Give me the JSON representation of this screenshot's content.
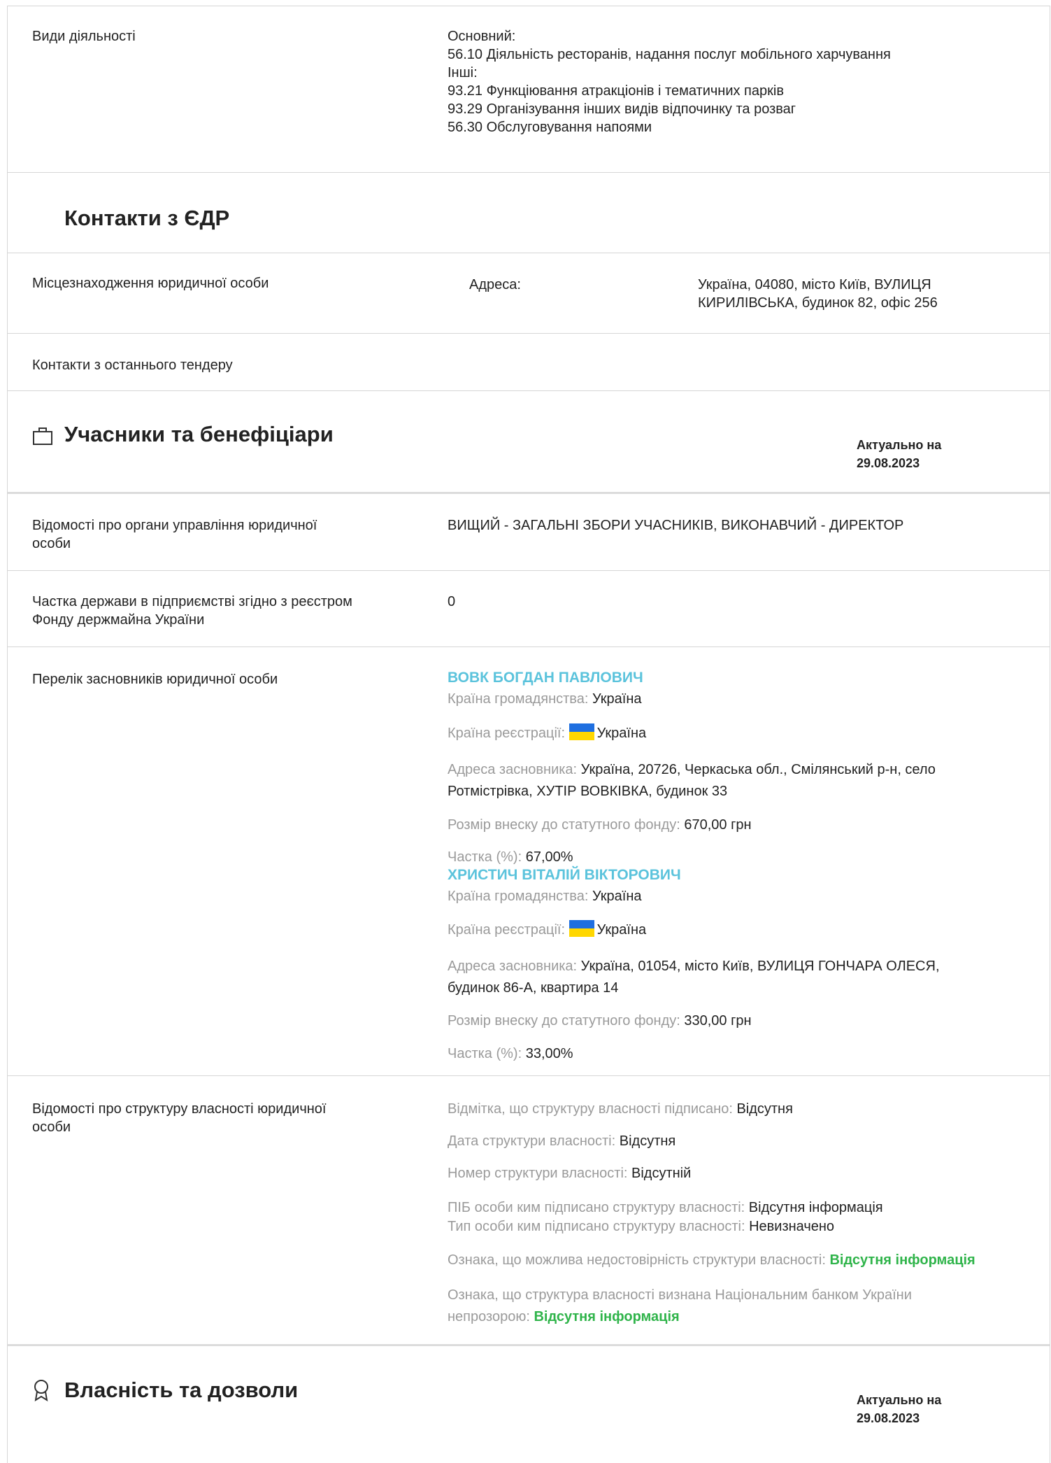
{
  "activities": {
    "label": "Види діяльності",
    "main_heading": "Основний:",
    "main_item": "56.10 Діяльність ресторанів, надання послуг мобільного харчування",
    "other_heading": "Інші:",
    "other_items": [
      "93.21 Функціювання атракціонів і тематичних парків",
      "93.29 Організування інших видів відпочинку та розваг",
      "56.30 Обслуговування напоями"
    ]
  },
  "contacts": {
    "title": "Контакти з ЄДР",
    "location_label": "Місцезнаходження юридичної особи",
    "address_label": "Адреса:",
    "address_line1": "Україна, 04080, місто Київ, ВУЛИЦЯ",
    "address_line2": "КИРИЛІВСЬКА, будинок 82, офіс 256",
    "tender_label": "Контакти з останнього тендеру"
  },
  "participants": {
    "title": "Учасники та бенефіціари",
    "actual_label": "Актуально на",
    "actual_date": "29.08.2023",
    "management_label_1": "Відомості про органи управління юридичної",
    "management_label_2": "особи",
    "management_value": "ВИЩИЙ - ЗАГАЛЬНІ ЗБОРИ УЧАСНИКІВ, ВИКОНАВЧИЙ - ДИРЕКТОР",
    "state_share_label_1": "Частка держави в підприємстві згідно з реєстром",
    "state_share_label_2": "Фонду держмайна України",
    "state_share_value": "0",
    "founders_label": "Перелік засновників юридичної особи",
    "founders": [
      {
        "name": "ВОВК БОГДАН ПАВЛОВИЧ",
        "citizenship_label": "Країна громадянства:",
        "citizenship": "Україна",
        "registration_label": "Країна реєстрації:",
        "registration": "Україна",
        "address_label": "Адреса засновника:",
        "address_line1": "Україна, 20726, Черкаська обл., Смілянський р-н, село",
        "address_line2": "Ротмістрівка, ХУТІР ВОВКІВКА, будинок 33",
        "contribution_label": "Розмір внеску до статутного фонду:",
        "contribution": "670,00 грн",
        "share_label": "Частка (%):",
        "share": "67,00%"
      },
      {
        "name": "ХРИСТИЧ ВІТАЛІЙ ВІКТОРОВИЧ",
        "citizenship_label": "Країна громадянства:",
        "citizenship": "Україна",
        "registration_label": "Країна реєстрації:",
        "registration": "Україна",
        "address_label": "Адреса засновника:",
        "address_line1": "Україна, 01054, місто Київ, ВУЛИЦЯ ГОНЧАРА ОЛЕСЯ,",
        "address_line2": "будинок 86-А, квартира 14",
        "contribution_label": "Розмір внеску до статутного фонду:",
        "contribution": "330,00 грн",
        "share_label": "Частка (%):",
        "share": "33,00%"
      }
    ],
    "ownership_label_1": "Відомості про структуру власності юридичної",
    "ownership_label_2": "особи",
    "ownership": {
      "signed_label": "Відмітка, що структуру власності підписано:",
      "signed_value": "Відсутня",
      "date_label": "Дата структури власності:",
      "date_value": "Відсутня",
      "number_label": "Номер структури власності:",
      "number_value": "Відсутній",
      "signer_label": "ПІБ особи ким підписано структуру власності:",
      "signer_value": "Відсутня інформація",
      "signer_type_label": "Тип особи ким підписано структуру власності:",
      "signer_type_value": "Невизначено",
      "unreliable_label": "Ознака, що можлива недостовірність структури власності:",
      "unreliable_value": "Відсутня інформація",
      "opaque_label_1": "Ознака, що структура власності визнана Національним банком України",
      "opaque_label_2": "непрозорою:",
      "opaque_value": "Відсутня інформація"
    }
  },
  "property": {
    "title": "Власність та дозволи",
    "actual_label": "Актуально на",
    "actual_date": "29.08.2023"
  },
  "colors": {
    "link": "#5bc3dc",
    "positive": "#2fb44a",
    "muted": "#9a9a9a",
    "flag_blue": "#1f6fe0",
    "flag_yellow": "#ffd700"
  },
  "icons": [
    "briefcase-icon",
    "award-icon",
    "ukraine-flag-icon"
  ]
}
